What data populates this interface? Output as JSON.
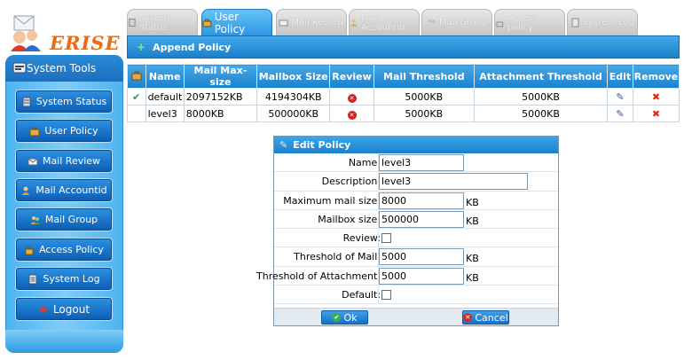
{
  "app": {
    "logo_text": "ERISE"
  },
  "sidebar": {
    "header": "System Tools",
    "items": [
      {
        "label": "System Status",
        "icon": "server-icon"
      },
      {
        "label": "User Policy",
        "icon": "briefcase-icon"
      },
      {
        "label": "Mail Review",
        "icon": "mail-icon"
      },
      {
        "label": "Mail Accountid",
        "icon": "user-icon"
      },
      {
        "label": "Mail Group",
        "icon": "group-icon"
      },
      {
        "label": "Access Policy",
        "icon": "lock-icon"
      },
      {
        "label": "System Log",
        "icon": "log-icon"
      },
      {
        "label": "Logout",
        "icon": "logout-arrow-icon"
      }
    ]
  },
  "tabs": [
    {
      "label": "System Status",
      "active": false
    },
    {
      "label": "User Policy",
      "active": true
    },
    {
      "label": "Mail Review",
      "active": false
    },
    {
      "label": "Mail Accountid",
      "active": false
    },
    {
      "label": "Mail Group",
      "active": false
    },
    {
      "label": "Access policy",
      "active": false
    },
    {
      "label": "System Log",
      "active": false
    }
  ],
  "panel": {
    "title": "Append Policy"
  },
  "table": {
    "columns": [
      "Name",
      "Mail Max-size",
      "Mailbox Size",
      "Review",
      "Mail Threshold",
      "Attachment Threshold",
      "Edit",
      "Remove"
    ],
    "rows": [
      {
        "selected": true,
        "name": "default",
        "mail_max": "2097152KB",
        "mailbox": "4194304KB",
        "review": "off",
        "mail_threshold": "5000KB",
        "attach_threshold": "5000KB"
      },
      {
        "selected": false,
        "name": "level3",
        "mail_max": "8000KB",
        "mailbox": "500000KB",
        "review": "off",
        "mail_threshold": "5000KB",
        "attach_threshold": "5000KB"
      }
    ]
  },
  "edit": {
    "title": "Edit Policy",
    "name_label": "Name:",
    "name_value": "level3",
    "desc_label": "Description:",
    "desc_value": "level3",
    "maxmail_label": "Maximum mail size:",
    "maxmail_value": "8000",
    "maxmail_unit": "KB",
    "mailbox_label": "Mailbox size:",
    "mailbox_value": "500000",
    "mailbox_unit": "KB",
    "review_label": "Review:",
    "review_checked": false,
    "thr_mail_label": "Threshold of Mail:",
    "thr_mail_value": "5000",
    "thr_mail_unit": "KB",
    "thr_att_label": "Threshold of Attachment:",
    "thr_att_value": "5000",
    "thr_att_unit": "KB",
    "default_label": "Default:",
    "default_checked": false,
    "ok_label": "Ok",
    "cancel_label": "Cancel"
  }
}
